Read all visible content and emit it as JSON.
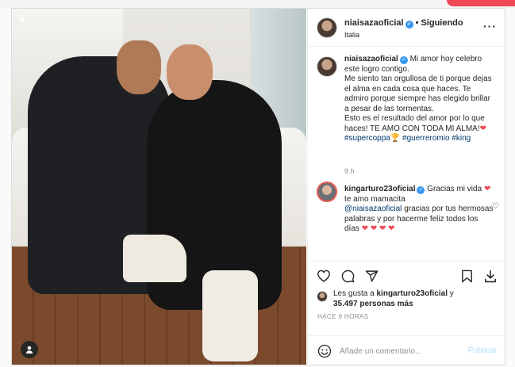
{
  "header": {
    "username": "niaisazaoficial",
    "follow_status": "Siguiendo",
    "location": "Italia"
  },
  "caption": {
    "username": "niaisazaoficial",
    "text1": "Mi amor hoy celebro este logro contigo.",
    "text2": "Me siento tan orgullosa de ti porque dejas el alma en cada cosa que haces. Te admiro porque siempre has elegido brillar a pesar de las tormentas.",
    "text3": "Esto es el resultado del amor por lo que haces! TE AMO CON TODA MI ALMA!",
    "hashtags": "#supercoppa🏆 #guerreromio #king",
    "time": "9 h"
  },
  "reply": {
    "username": "kingarturo23oficial",
    "text1": "Gracias mi vida",
    "text2": "te amo mamacita",
    "mention": "@niaisazaoficial",
    "text3": "gracias por tus hermosas palabras y por hacerme feliz todos los días"
  },
  "likes": {
    "prefix": "Les gusta a",
    "user": "kingarturo23oficial",
    "connector": "y",
    "count": "35.497 personas más"
  },
  "posted": "HACE 9 HORAS",
  "add_comment": {
    "placeholder": "Añade un comentario...",
    "publish": "Publicar"
  },
  "icons": {
    "verified": "verified-badge-icon",
    "heart": "heart-emoji-icon",
    "like": "heart-outline-icon",
    "comment": "comment-icon",
    "share": "paper-plane-icon",
    "save": "bookmark-icon",
    "download": "download-icon",
    "emoji": "smiley-icon",
    "more": "more-dots-icon"
  },
  "colors": {
    "link": "#00376b",
    "verified": "#3897f0",
    "heart": "#ed4956",
    "publish_disabled": "#b2dffc"
  }
}
